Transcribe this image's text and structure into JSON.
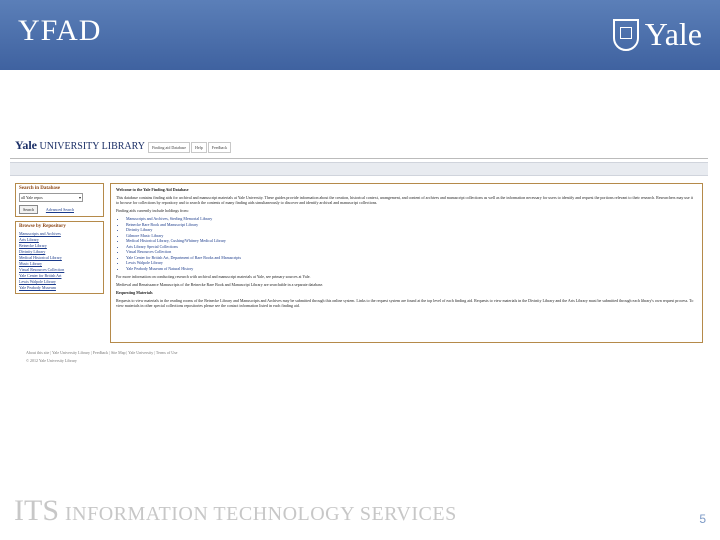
{
  "slide": {
    "title": "YFAD",
    "brand": "Yale",
    "footer_mark": "ITS",
    "footer_text": "INFORMATION TECHNOLOGY SERVICES",
    "page_number": "5"
  },
  "site": {
    "logo_bold": "Yale",
    "logo_rest": "UNIVERSITY LIBRARY",
    "tabs": [
      "Finding aid Database",
      "Help",
      "Feedback"
    ]
  },
  "search_panel": {
    "heading": "Search in Database",
    "select_value": "all Yale repos",
    "search_button": "Search",
    "advanced_link": "Advanced Search"
  },
  "browse_panel": {
    "heading": "Browse by Repository",
    "items": [
      "Manuscripts and Archives",
      "Arts Library",
      "Beinecke Library",
      "Divinity Library",
      "Medical Historical Library",
      "Music Library",
      "Visual Resources Collection",
      "Yale Center for British Art",
      "Lewis Walpole Library",
      "Yale Peabody Museum"
    ]
  },
  "main": {
    "welcome": "Welcome to the Yale Finding Aid Database",
    "intro": "This database contains finding aids for archival and manuscript materials at Yale University. These guides provide information about the creation, historical context, arrangement, and content of archives and manuscript collections as well as the information necessary for users to identify and request the portions relevant to their research. Researchers may use it to browse for collections by repository and to search the contents of many finding aids simultaneously to discover and identify archival and manuscript collections.",
    "list_heading": "Finding aids currently include holdings from:",
    "repositories": [
      "Manuscripts and Archives, Sterling Memorial Library",
      "Beinecke Rare Book and Manuscript Library",
      "Divinity Library",
      "Gilmore Music Library",
      "Medical Historical Library, Cushing/Whitney Medical Library",
      "Arts Library Special Collections",
      "Visual Resources Collection",
      "Yale Center for British Art, Department of Rare Books and Manuscripts",
      "Lewis Walpole Library",
      "Yale Peabody Museum of Natural History"
    ],
    "more_info": "For more information on conducting research with archival and manuscript materials at Yale, see primary sources at Yale.",
    "medieval": "Medieval and Renaissance Manuscripts of the Beinecke Rare Book and Manuscript Library are searchable in a separate database.",
    "requesting_heading": "Requesting Materials",
    "requesting_text": "Requests to view materials in the reading rooms of the Beinecke Library and Manuscripts and Archives may be submitted through this online system. Links to the request system are found at the top level of each finding aid. Requests to view materials in the Divinity Library and the Arts Library must be submitted through each library's own request process. To view materials in other special collections repositories please see the contact information listed in each finding aid."
  },
  "site_footer": {
    "links": "About this site | Yale University Library | Feedback | Site Map | Yale University | Terms of Use",
    "copyright": "© 2012 Yale University Library"
  },
  "colors": {
    "banner": "#4a6ea9",
    "panel_border": "#b58a4a",
    "link": "#1a3a8a"
  }
}
